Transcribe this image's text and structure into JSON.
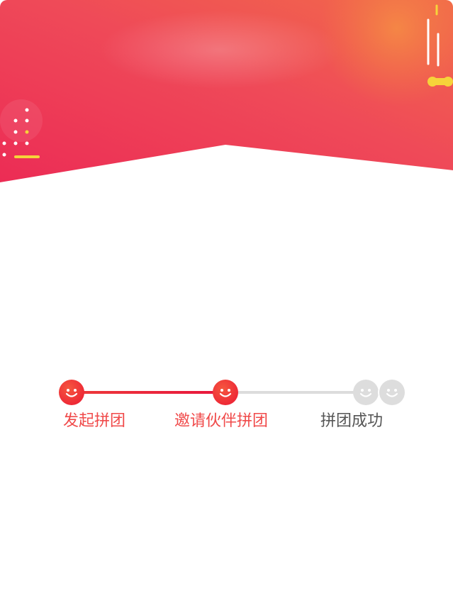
{
  "banner": {
    "gradient_start": "#ee3457",
    "gradient_end": "#f07a4b",
    "accent_yellow": "#f6d33a"
  },
  "steps": {
    "active_color": "#f04a4a",
    "inactive_color": "#555555",
    "items": [
      {
        "label": "发起拼团",
        "state": "done",
        "icon": "smiley-icon"
      },
      {
        "label": "邀请伙伴拼团",
        "state": "current",
        "icon": "smiley-icon"
      },
      {
        "label": "拼团成功",
        "state": "pending",
        "icon": "double-smiley-icon"
      }
    ]
  }
}
